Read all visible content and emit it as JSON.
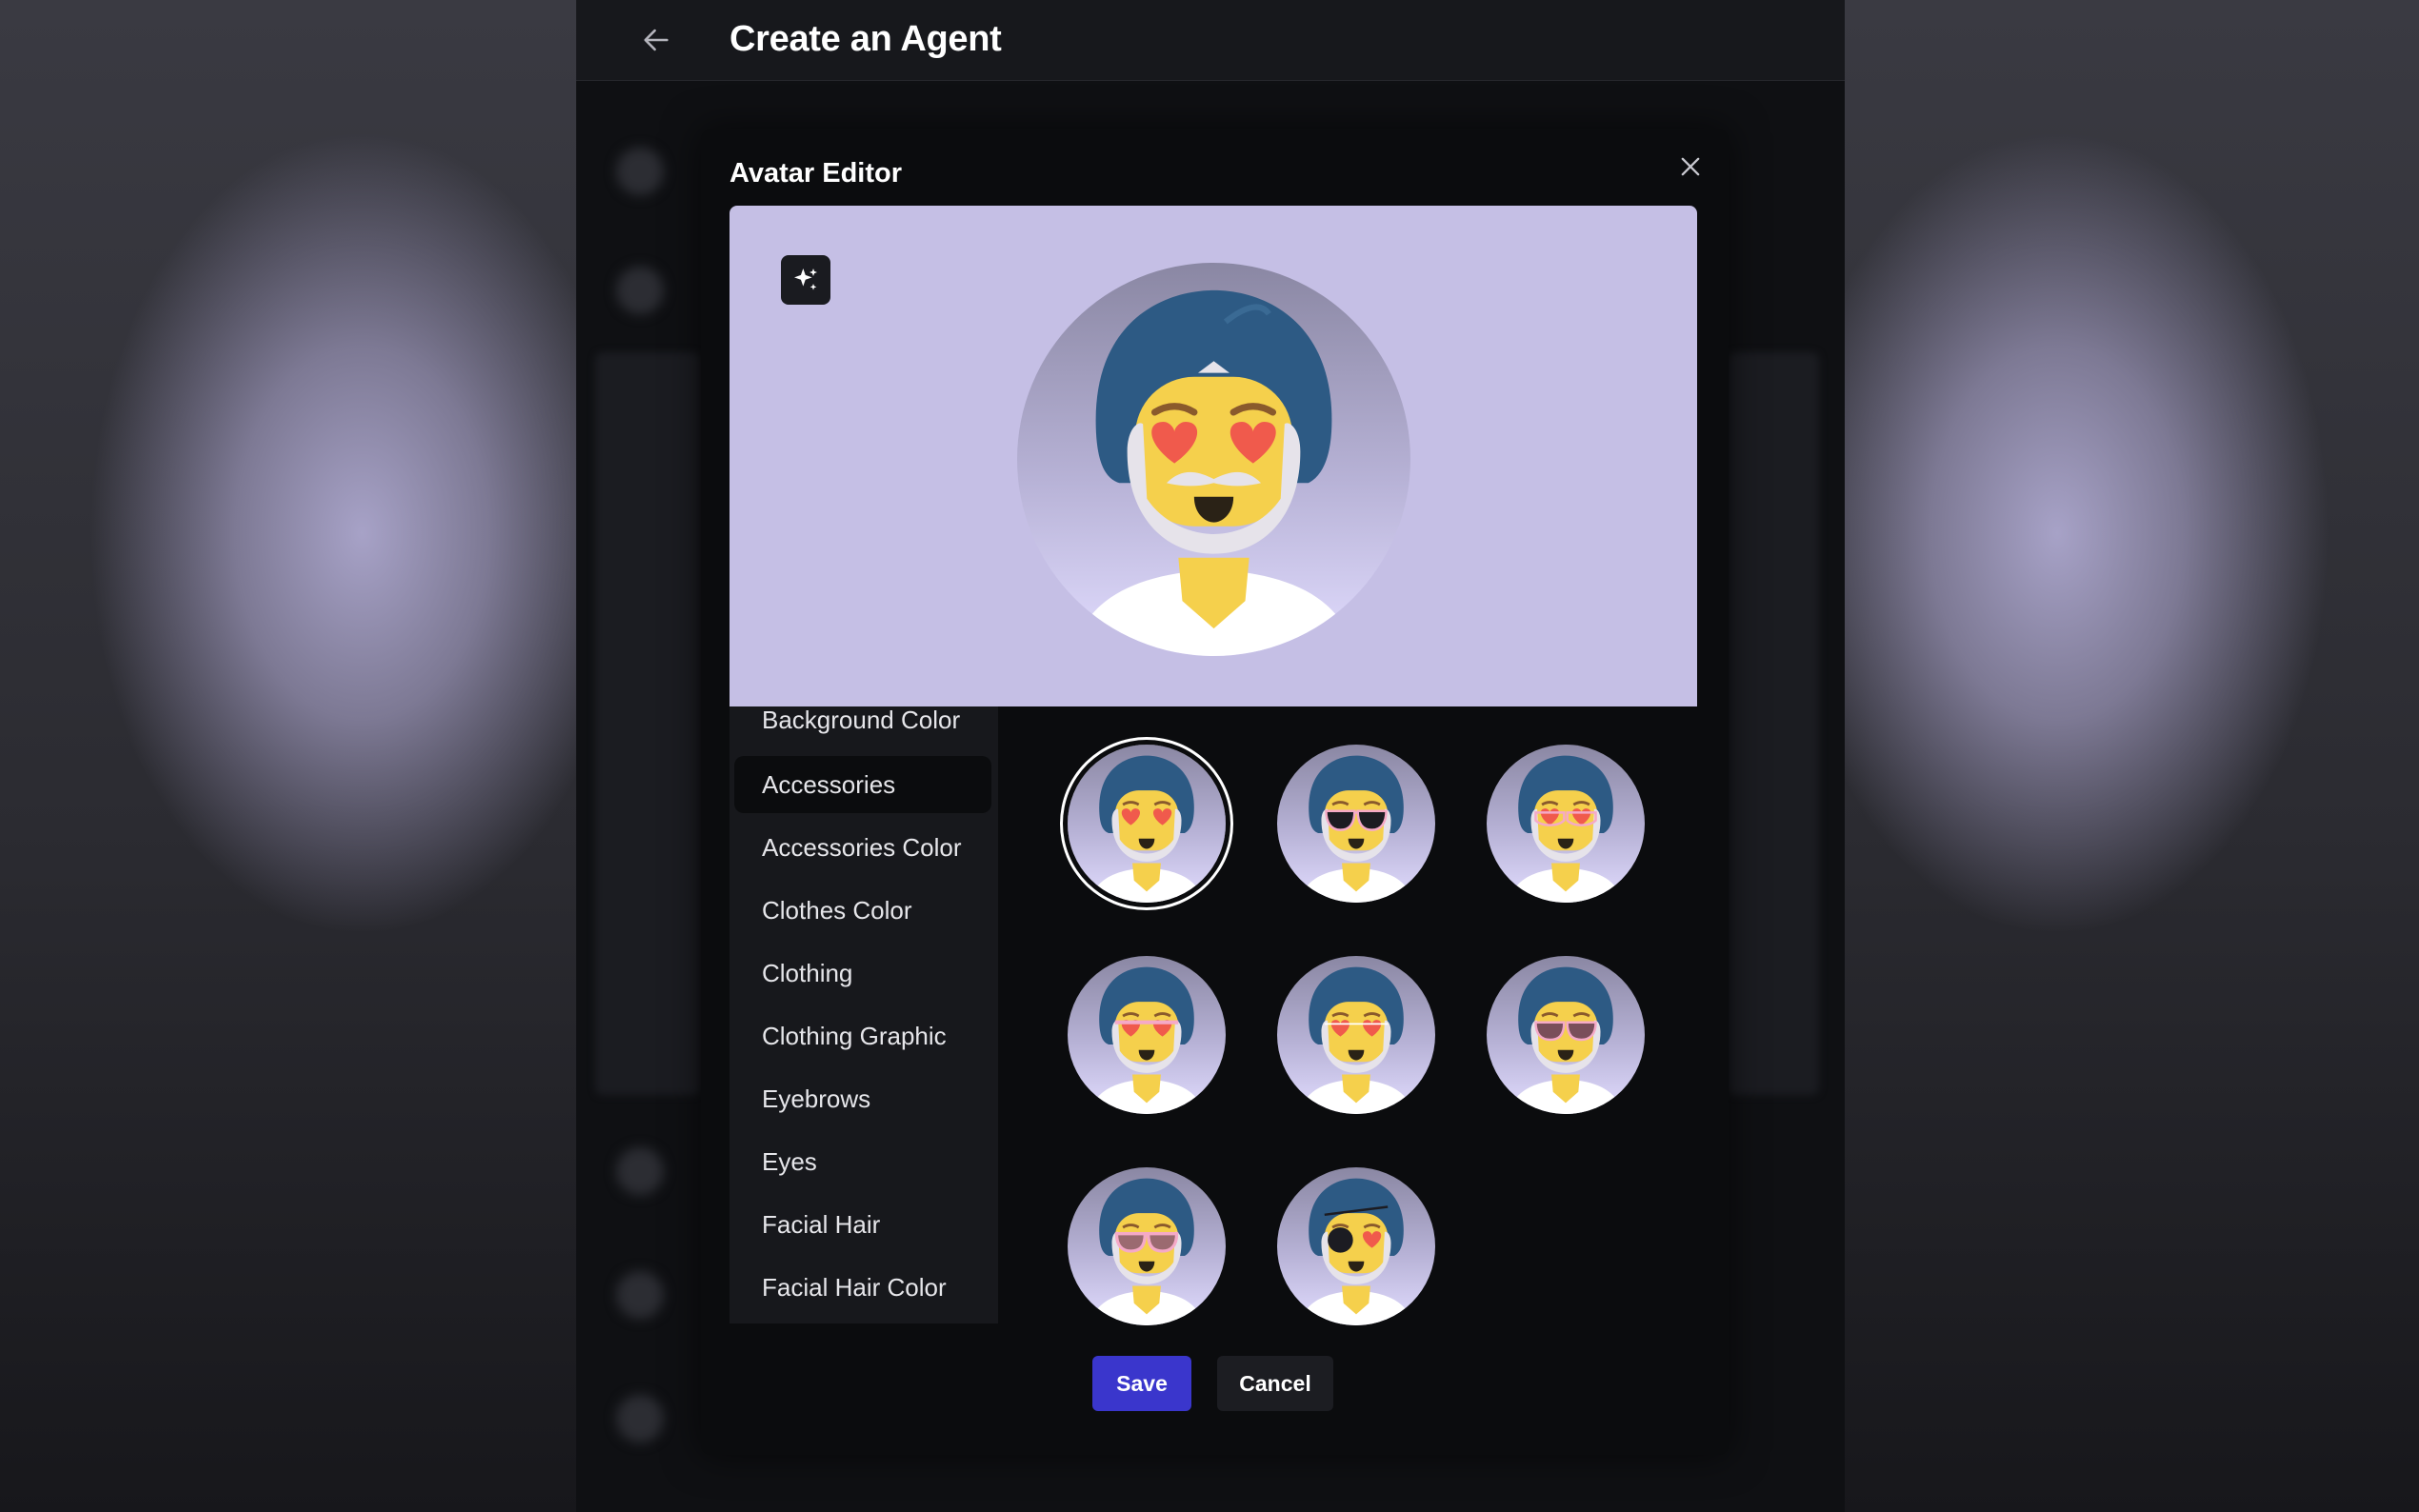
{
  "header": {
    "title": "Create an Agent",
    "back_icon": "arrow-left-icon"
  },
  "modal": {
    "title": "Avatar Editor",
    "close_icon": "close-icon",
    "randomize_icon": "sparkles-icon",
    "categories": [
      {
        "label": "Background Color",
        "active": false
      },
      {
        "label": "Accessories",
        "active": true
      },
      {
        "label": "Accessories Color",
        "active": false
      },
      {
        "label": "Clothes Color",
        "active": false
      },
      {
        "label": "Clothing",
        "active": false
      },
      {
        "label": "Clothing Graphic",
        "active": false
      },
      {
        "label": "Eyebrows",
        "active": false
      },
      {
        "label": "Eyes",
        "active": false
      },
      {
        "label": "Facial Hair",
        "active": false
      },
      {
        "label": "Facial Hair Color",
        "active": false
      }
    ],
    "options": [
      {
        "accessory": "hearts",
        "selected": true
      },
      {
        "accessory": "sunglasses",
        "selected": false
      },
      {
        "accessory": "hearts-glasses",
        "selected": false
      },
      {
        "accessory": "hearts-pink-glasses",
        "selected": false
      },
      {
        "accessory": "hearts-thin-glasses",
        "selected": false
      },
      {
        "accessory": "round-glasses",
        "selected": false
      },
      {
        "accessory": "pink-sunglasses",
        "selected": false
      },
      {
        "accessory": "eyepatch",
        "selected": false
      }
    ],
    "save_label": "Save",
    "cancel_label": "Cancel"
  },
  "colors": {
    "accent": "#3a36cc",
    "preview_bg": "#c5bfe5",
    "turban": "#2d5a84",
    "skin": "#f5d04c",
    "beard": "#e6e3ea",
    "heart": "#f05a4c"
  }
}
